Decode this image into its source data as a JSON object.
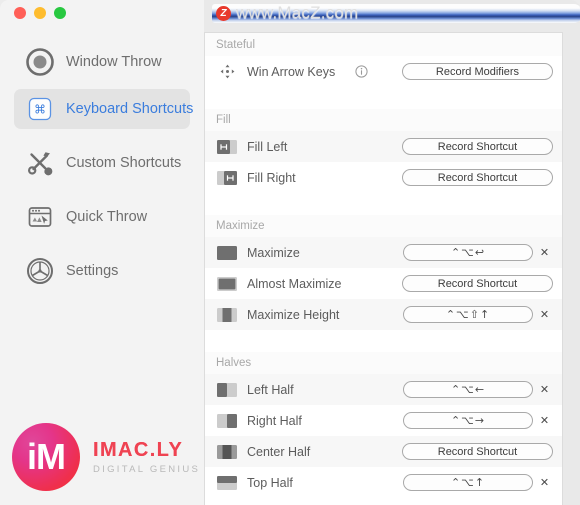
{
  "window": {
    "traffic_lights": [
      "close",
      "minimize",
      "zoom"
    ],
    "colors": {
      "accent": "#3b7ddd",
      "sidebar_bg": "#f3f3f3",
      "panel_bg": "#ffffff",
      "row_alt_bg": "#f7f7f7"
    }
  },
  "sidebar": {
    "items": [
      {
        "label": "Window Throw",
        "icon": "target-circle-icon",
        "selected": false
      },
      {
        "label": "Keyboard Shortcuts",
        "icon": "command-key-icon",
        "selected": true
      },
      {
        "label": "Custom Shortcuts",
        "icon": "wrench-screwdriver-icon",
        "selected": false
      },
      {
        "label": "Quick Throw",
        "icon": "window-cursor-icon",
        "selected": false
      },
      {
        "label": "Settings",
        "icon": "gear-compass-icon",
        "selected": false
      }
    ]
  },
  "main": {
    "sections": [
      {
        "title": "Stateful",
        "rows": [
          {
            "label": "Win Arrow Keys",
            "icon": "move-arrows-icon",
            "info": "info-icon",
            "button_label": "Record Modifiers",
            "shortcut": "",
            "has_clear": false
          }
        ]
      },
      {
        "title": "Fill",
        "rows": [
          {
            "label": "Fill Left",
            "icon": "fill-left-icon",
            "info": "",
            "button_label": "Record Shortcut",
            "shortcut": "",
            "has_clear": false
          },
          {
            "label": "Fill Right",
            "icon": "fill-right-icon",
            "info": "",
            "button_label": "Record Shortcut",
            "shortcut": "",
            "has_clear": false
          }
        ]
      },
      {
        "title": "Maximize",
        "rows": [
          {
            "label": "Maximize",
            "icon": "maximize-icon",
            "info": "",
            "button_label": "",
            "shortcut": "⌃⌥↩",
            "has_clear": true
          },
          {
            "label": "Almost Maximize",
            "icon": "almost-maximize-icon",
            "info": "",
            "button_label": "Record Shortcut",
            "shortcut": "",
            "has_clear": false
          },
          {
            "label": "Maximize Height",
            "icon": "maximize-height-icon",
            "info": "",
            "button_label": "",
            "shortcut": "⌃⌥⇧↑",
            "has_clear": true
          }
        ]
      },
      {
        "title": "Halves",
        "rows": [
          {
            "label": "Left Half",
            "icon": "left-half-icon",
            "info": "",
            "button_label": "",
            "shortcut": "⌃⌥←",
            "has_clear": true
          },
          {
            "label": "Right Half",
            "icon": "right-half-icon",
            "info": "",
            "button_label": "",
            "shortcut": "⌃⌥→",
            "has_clear": true
          },
          {
            "label": "Center Half",
            "icon": "center-half-icon",
            "info": "",
            "button_label": "Record Shortcut",
            "shortcut": "",
            "has_clear": false
          },
          {
            "label": "Top Half",
            "icon": "top-half-icon",
            "info": "",
            "button_label": "",
            "shortcut": "⌃⌥↑",
            "has_clear": true
          }
        ]
      }
    ],
    "clear_symbol": "✕"
  },
  "watermark_top": {
    "logo_letter": "Z",
    "text": "www.MacZ.com"
  },
  "watermark_bottom": {
    "logo_text": "iM",
    "brand": "IMAC.LY",
    "tagline": "DIGITAL GENIUS"
  }
}
